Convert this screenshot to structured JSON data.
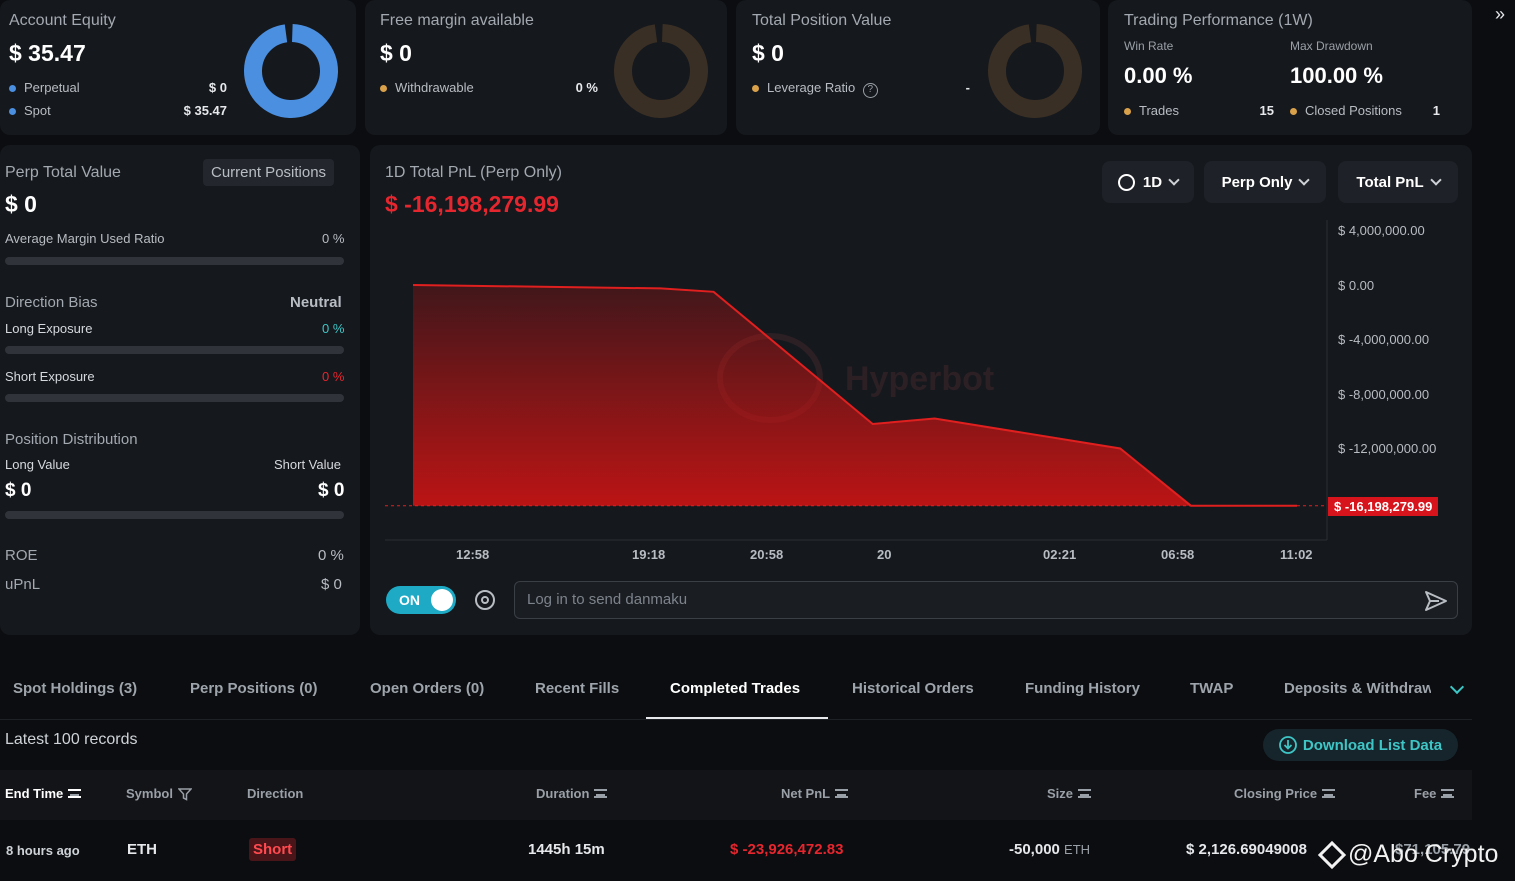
{
  "top_cards": {
    "account_equity": {
      "title": "Account Equity",
      "value": "$ 35.47",
      "rows": [
        {
          "label": "Perpetual",
          "value": "$ 0"
        },
        {
          "label": "Spot",
          "value": "$ 35.47"
        }
      ]
    },
    "free_margin": {
      "title": "Free margin available",
      "value": "$ 0",
      "rows": [
        {
          "label": "Withdrawable",
          "value": "0 %"
        }
      ]
    },
    "position_value": {
      "title": "Total Position Value",
      "value": "$ 0",
      "rows": [
        {
          "label": "Leverage Ratio",
          "value": "-"
        }
      ]
    },
    "performance": {
      "title": "Trading Performance (1W)",
      "win_rate_label": "Win Rate",
      "win_rate": "0.00 %",
      "drawdown_label": "Max Drawdown",
      "drawdown": "100.00 %",
      "trades_label": "Trades",
      "trades": "15",
      "closed_label": "Closed Positions",
      "closed": "1"
    }
  },
  "perp_panel": {
    "title": "Perp Total Value",
    "current_btn": "Current Positions",
    "value": "$ 0",
    "margin_label": "Average Margin Used Ratio",
    "margin_value": "0 %",
    "bias_label": "Direction Bias",
    "bias_value": "Neutral",
    "long_label": "Long Exposure",
    "long_value": "0 %",
    "short_label": "Short Exposure",
    "short_value": "0 %",
    "dist_label": "Position Distribution",
    "long_val_label": "Long Value",
    "short_val_label": "Short Value",
    "long_val": "$ 0",
    "short_val": "$ 0",
    "roe_label": "ROE",
    "roe_value": "0 %",
    "upnl_label": "uPnL",
    "upnl_value": "$ 0"
  },
  "chart_panel": {
    "title": "1D Total PnL (Perp Only)",
    "value": "$ -16,198,279.99",
    "period": "1D",
    "scope": "Perp Only",
    "metric": "Total PnL",
    "watermark": "Hyperbot",
    "toggle": "ON",
    "danmaku_placeholder": "Log in to send danmaku"
  },
  "chart_data": {
    "type": "area",
    "x": [
      "12:58",
      "19:18",
      "20:58",
      "20",
      "02:21",
      "06:58",
      "11:02"
    ],
    "series": [
      {
        "points": [
          [
            0,
            0
          ],
          [
            0.28,
            -250000
          ],
          [
            0.34,
            -500000
          ],
          [
            0.52,
            -10200000
          ],
          [
            0.59,
            -9800000
          ],
          [
            0.8,
            -12000000
          ],
          [
            0.88,
            -16198279.99
          ],
          [
            1,
            -16198279.99
          ]
        ]
      }
    ],
    "yticks": [
      "$ 4,000,000.00",
      "$ 0.00",
      "$ -4,000,000.00",
      "$ -8,000,000.00",
      "$ -12,000,000.00"
    ],
    "current_label": "$ -16,198,279.99",
    "ylim": [
      -16198279.99,
      4000000
    ],
    "colors": {
      "line": "#e01f1f",
      "fill": "#c41414"
    }
  },
  "tabs": [
    "Spot Holdings (3)",
    "Perp Positions (0)",
    "Open Orders (0)",
    "Recent Fills",
    "Completed Trades",
    "Historical Orders",
    "Funding History",
    "TWAP",
    "Deposits & Withdraw"
  ],
  "table": {
    "records": "Latest 100 records",
    "download": "Download List Data",
    "headers": [
      "End Time",
      "Symbol",
      "Direction",
      "Duration",
      "Net PnL",
      "Size",
      "Closing Price",
      "Fee"
    ],
    "row": {
      "end_time": "8 hours ago",
      "symbol": "ETH",
      "direction": "Short",
      "duration": "1445h 15m",
      "net_pnl": "$ -23,926,472.83",
      "size": "-50,000",
      "size_unit": "ETH",
      "closing_price": "$ 2,126.69049008",
      "fee": "$71,105.79"
    }
  },
  "watermark_credit": "@Abo Crypto",
  "colors": {
    "accent": "#4a8fe0",
    "neg": "#e6262e",
    "pos": "#3ec6c6",
    "orange": "#d9a24a",
    "toggle": "#1ea9c4"
  }
}
